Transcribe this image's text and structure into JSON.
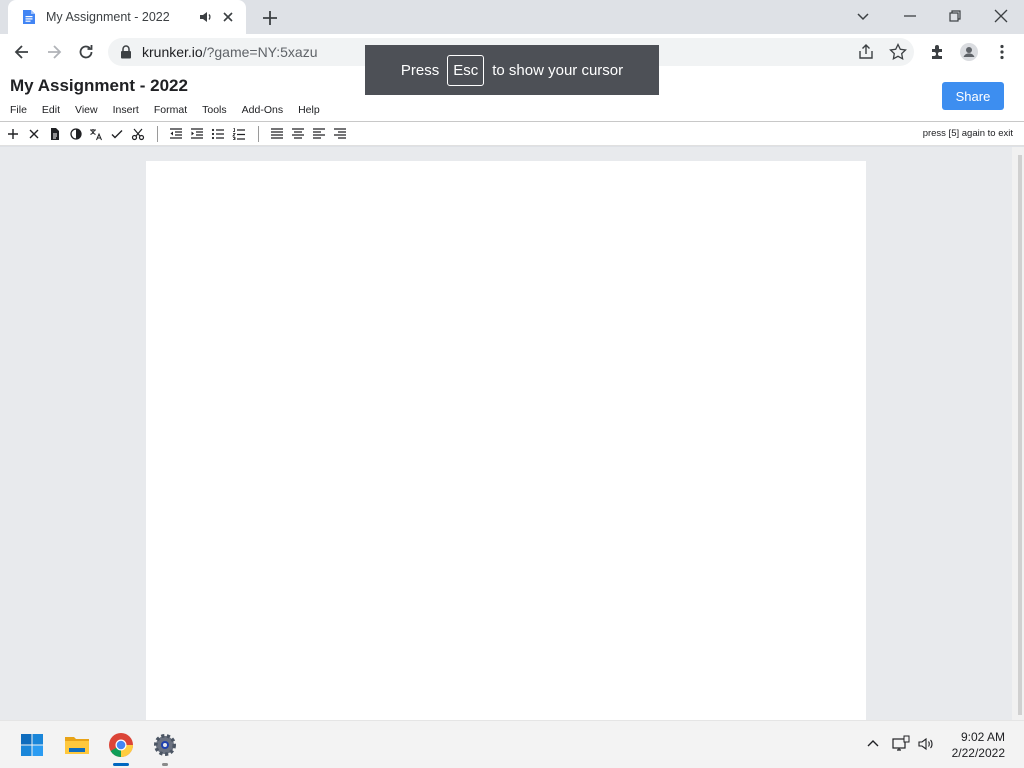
{
  "browser": {
    "tab": {
      "title": "My Assignment - 2022"
    },
    "url": {
      "host": "krunker.io",
      "path": "/?game=NY:5xazu"
    }
  },
  "overlay": {
    "press": "Press",
    "key": "Esc",
    "message": "to show your cursor"
  },
  "docs": {
    "title": "My Assignment - 2022",
    "menu": [
      "File",
      "Edit",
      "View",
      "Insert",
      "Format",
      "Tools",
      "Add-Ons",
      "Help"
    ],
    "share_label": "Share",
    "exit_hint": "press [5] again to exit"
  },
  "taskbar": {
    "time": "9:02 AM",
    "date": "2/22/2022"
  },
  "colors": {
    "accent": "#3d8ef0",
    "overlay": "#4d5056",
    "chrome_frame": "#dee1e6"
  },
  "icons": {
    "toolbar": [
      "plus",
      "close",
      "document",
      "contrast",
      "translate",
      "check",
      "scissors",
      "indent-decrease",
      "indent-increase",
      "bulleted-list",
      "numbered-list",
      "align-justify",
      "align-center",
      "align-left",
      "align-right"
    ]
  }
}
